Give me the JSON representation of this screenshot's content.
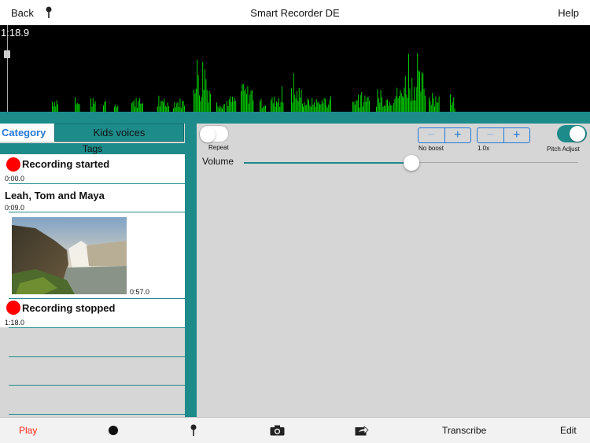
{
  "topbar": {
    "back": "Back",
    "title": "Smart Recorder DE",
    "help": "Help"
  },
  "waveform": {
    "time": "1:18.9",
    "color": "#00cc00"
  },
  "category": {
    "label": "Category",
    "value": "Kids voices"
  },
  "tags": {
    "header": "Tags",
    "items": [
      {
        "title": "Recording started",
        "time": "0:00.0"
      },
      {
        "title": "Leah, Tom and Maya",
        "time": "0:09.0"
      },
      {
        "time": "0:57.0"
      },
      {
        "title": "Recording stopped",
        "time": "1:18.0"
      }
    ]
  },
  "controls": {
    "repeat": "Repeat",
    "boost": "No boost",
    "speed": "1.0x",
    "pitch": "Pitch Adjust",
    "volume": "Volume",
    "volume_level": 0.5
  },
  "toolbar": {
    "play": "Play",
    "transcribe": "Transcribe",
    "edit": "Edit"
  }
}
